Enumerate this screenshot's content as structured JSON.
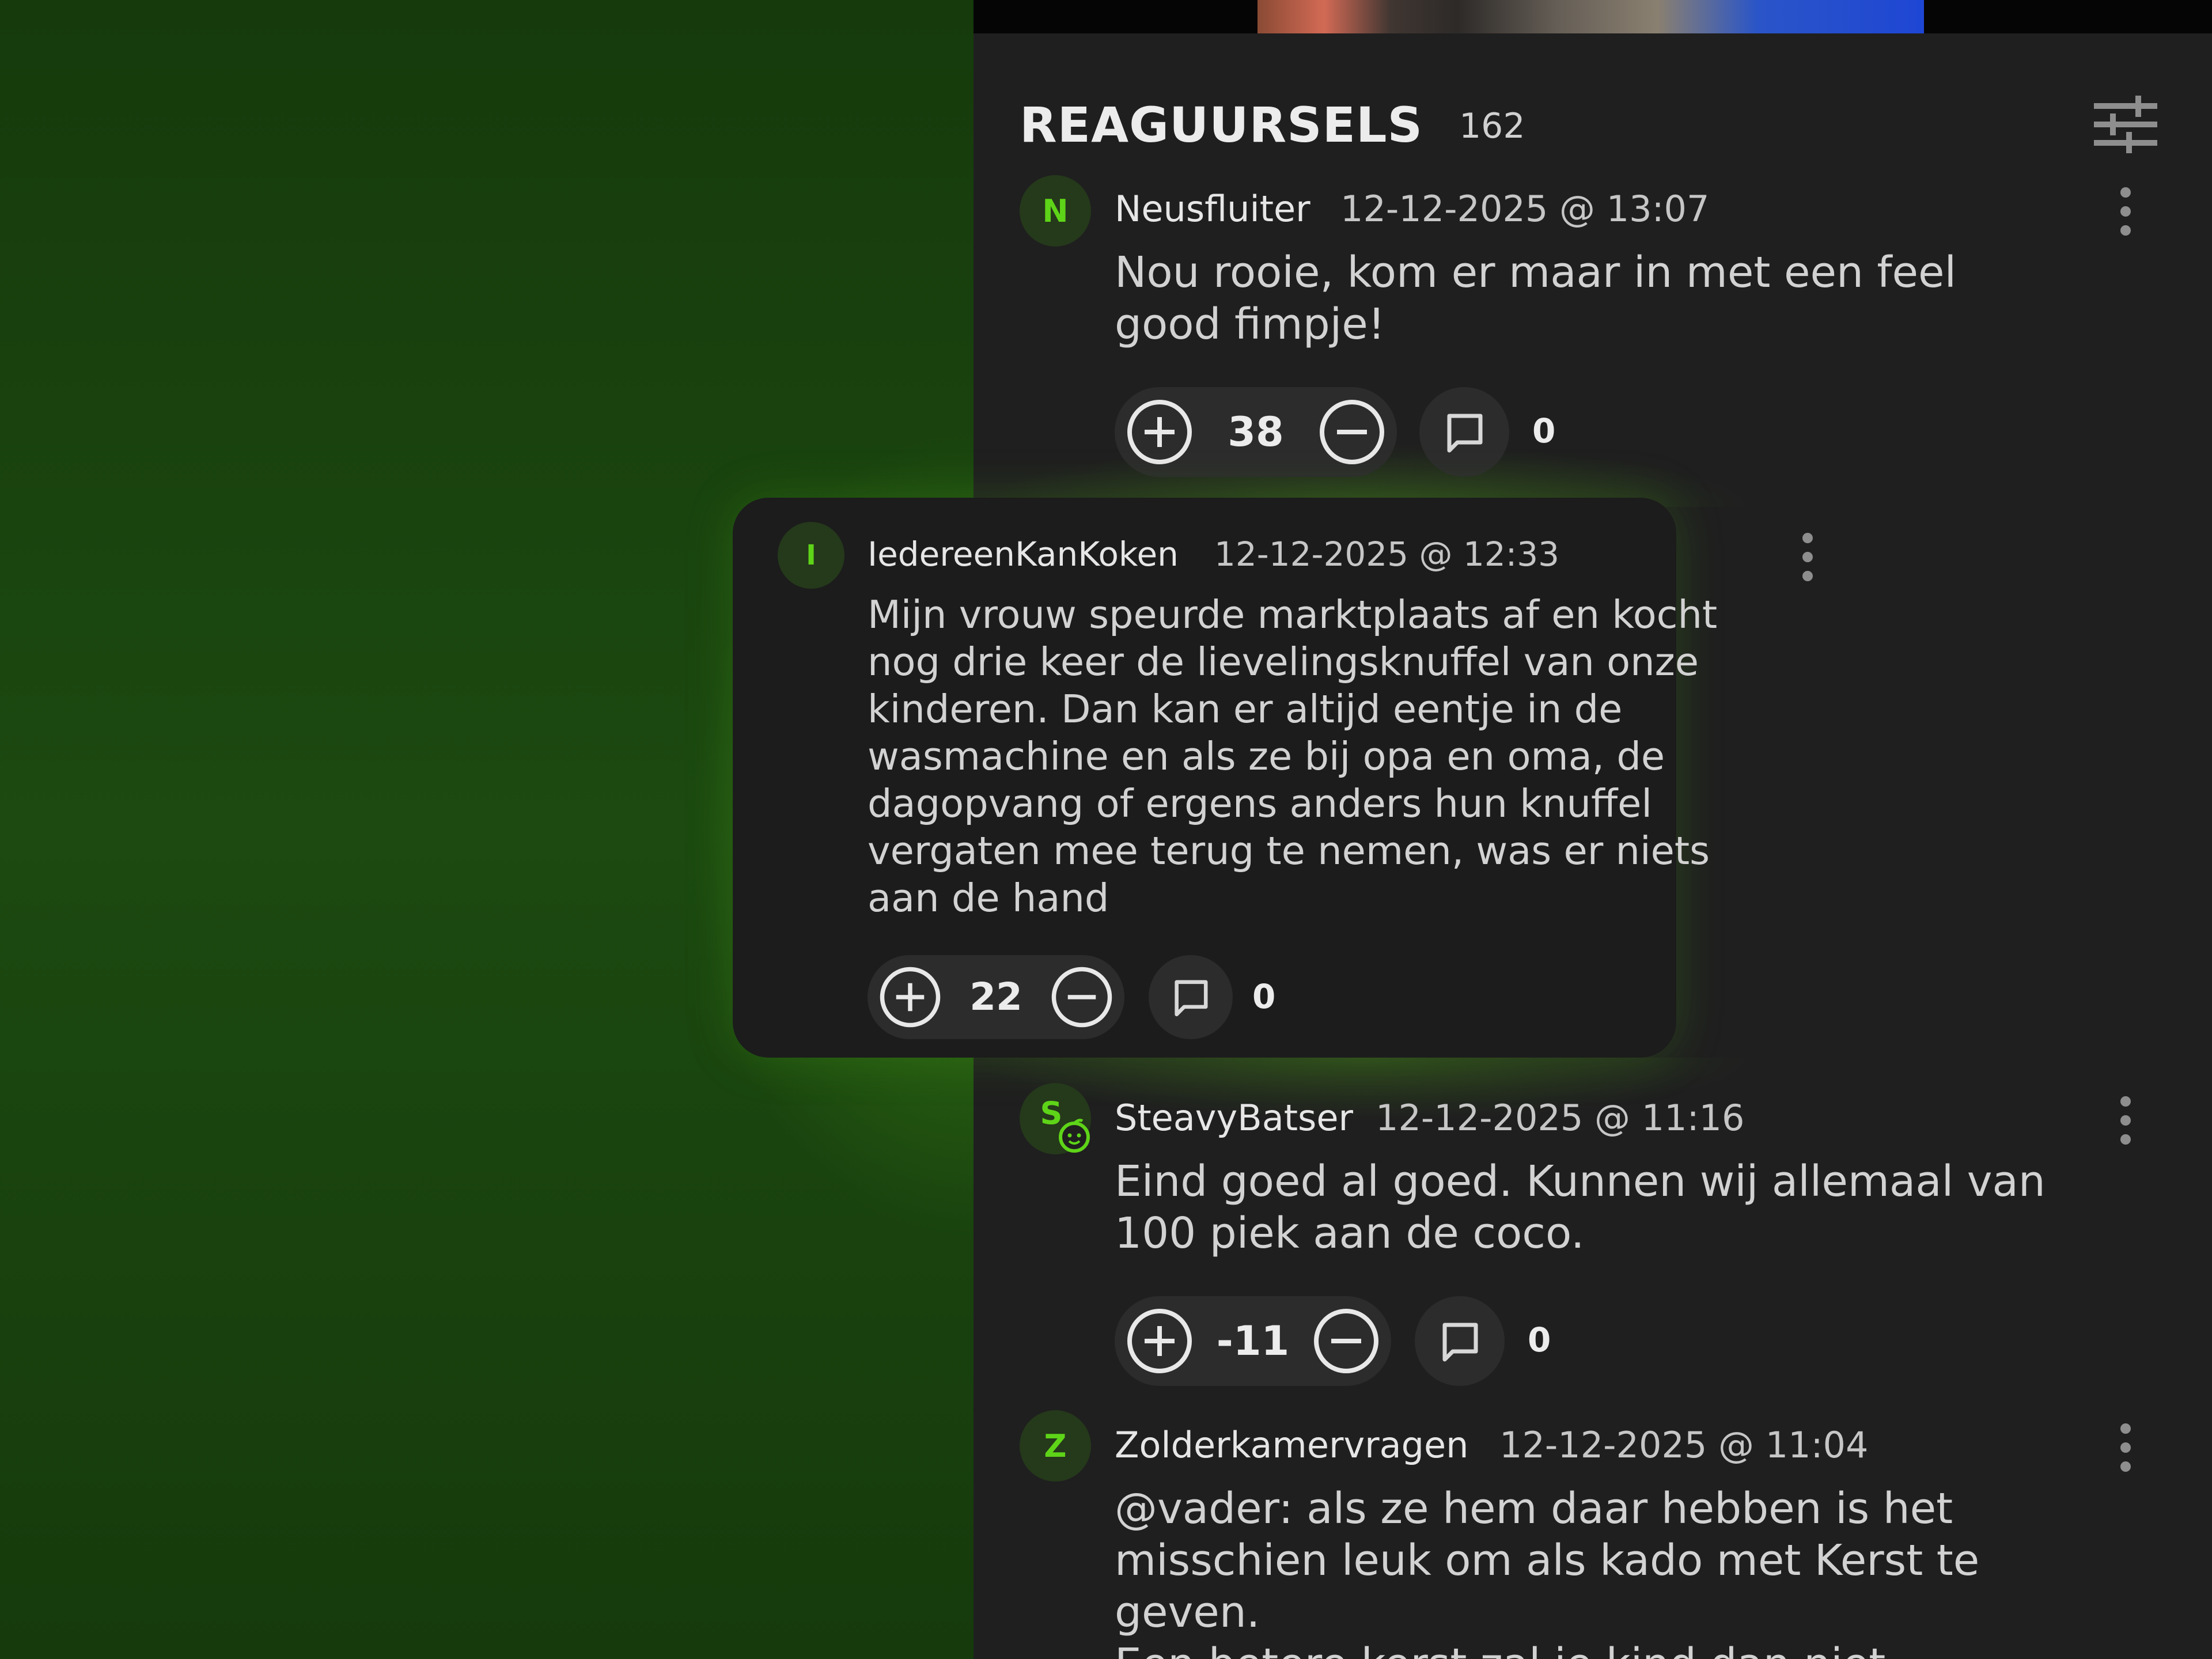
{
  "header": {
    "title": "REAGUURSELS",
    "count": "162"
  },
  "comments": [
    {
      "avatar_letter": "N",
      "username": "Neusfluiter",
      "timestamp": "12-12-2025 @ 13:07",
      "text": "Nou rooie, kom er maar in met een feel good fimpje!",
      "score": "38",
      "replies": "0"
    },
    {
      "avatar_letter": "I",
      "username": "IedereenKanKoken",
      "timestamp": "12-12-2025 @ 12:33",
      "text": "Mijn vrouw speurde marktplaats af en kocht nog drie keer de lievelingsknuffel van onze kinderen. Dan kan er altijd eentje in de wasmachine en als ze bij opa en oma, de dagopvang of ergens anders hun knuffel vergaten mee terug te nemen, was er niets aan de hand",
      "score": "22",
      "replies": "0",
      "highlighted": true
    },
    {
      "avatar_letter": "S",
      "avatar_badge": "baby-face-icon",
      "username": "SteavyBatser",
      "timestamp": "12-12-2025 @ 11:16",
      "text": "Eind goed al goed. Kunnen wij allemaal van 100 piek aan de coco.",
      "score": "-11",
      "replies": "0"
    },
    {
      "avatar_letter": "Z",
      "username": "Zolderkamervragen",
      "timestamp": "12-12-2025 @ 11:04",
      "text": "@vader: als ze hem daar hebben is het misschien leuk om als kado met Kerst te geven.\nEen betere kerst zal je kind dan niet hebben!"
    }
  ],
  "colors": {
    "accent": "#5ed418",
    "avatar_bg": "#25391b",
    "panel_bg": "#1f1f1f",
    "pill_bg": "#2c2c2c",
    "left_bg": "#1c4a10"
  },
  "icons": {
    "filter": "sliders-icon",
    "more": "kebab-menu-icon",
    "upvote": "plus-circle-icon",
    "downvote": "minus-circle-icon",
    "reply": "speech-bubble-icon"
  }
}
